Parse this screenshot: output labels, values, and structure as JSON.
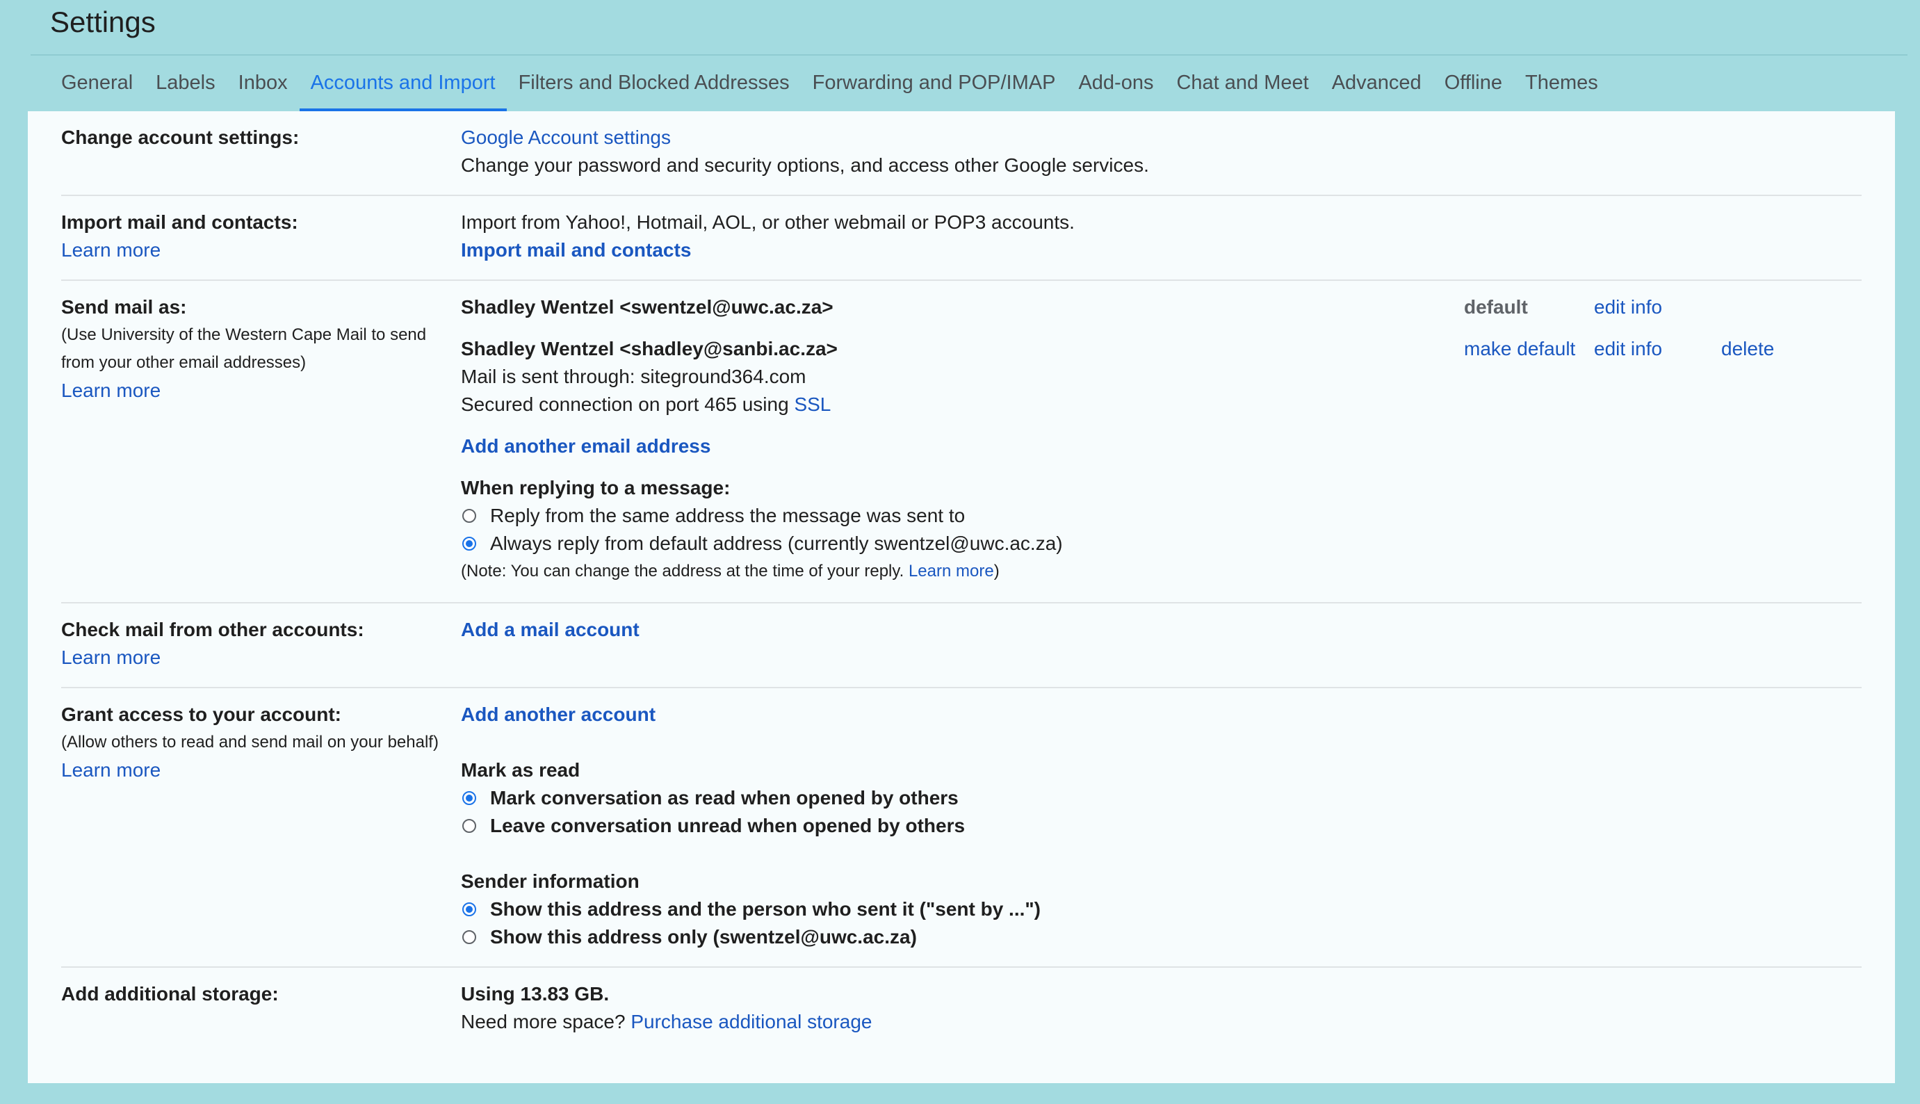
{
  "page": {
    "title": "Settings"
  },
  "tabs": [
    {
      "label": "General"
    },
    {
      "label": "Labels"
    },
    {
      "label": "Inbox"
    },
    {
      "label": "Accounts and Import"
    },
    {
      "label": "Filters and Blocked Addresses"
    },
    {
      "label": "Forwarding and POP/IMAP"
    },
    {
      "label": "Add-ons"
    },
    {
      "label": "Chat and Meet"
    },
    {
      "label": "Advanced"
    },
    {
      "label": "Offline"
    },
    {
      "label": "Themes"
    }
  ],
  "active_tab": "Accounts and Import",
  "change_account": {
    "label": "Change account settings:",
    "link": "Google Account settings",
    "description": "Change your password and security options, and access other Google services."
  },
  "import": {
    "label": "Import mail and contacts:",
    "learn_more": "Learn more",
    "description": "Import from Yahoo!, Hotmail, AOL, or other webmail or POP3 accounts.",
    "action": "Import mail and contacts"
  },
  "send_as": {
    "label": "Send mail as:",
    "note_line1": "(Use University of the Western Cape Mail to send",
    "note_line2": "from your other email addresses)",
    "learn_more": "Learn more",
    "accounts": [
      {
        "address": "Shadley Wentzel <swentzel@uwc.ac.za>",
        "status": "default",
        "edit": "edit info"
      },
      {
        "address": "Shadley Wentzel <shadley@sanbi.ac.za>",
        "status": "make default",
        "edit": "edit info",
        "delete": "delete",
        "sent_through": "Mail is sent through: siteground364.com",
        "secured_prefix": "Secured connection on port 465 using ",
        "secured_link": "SSL"
      }
    ],
    "add_address": "Add another email address",
    "reply_heading": "When replying to a message:",
    "reply_options": [
      {
        "label": "Reply from the same address the message was sent to",
        "checked": false
      },
      {
        "label": "Always reply from default address (currently swentzel@uwc.ac.za)",
        "checked": true
      }
    ],
    "reply_note_prefix": "(Note: You can change the address at the time of your reply. ",
    "reply_note_link": "Learn more",
    "reply_note_suffix": ")"
  },
  "check_mail": {
    "label": "Check mail from other accounts:",
    "learn_more": "Learn more",
    "action": "Add a mail account"
  },
  "grant_access": {
    "label": "Grant access to your account:",
    "note": "(Allow others to read and send mail on your behalf)",
    "learn_more": "Learn more",
    "action": "Add another account",
    "mark_heading": "Mark as read",
    "mark_options": [
      {
        "label": "Mark conversation as read when opened by others",
        "checked": true
      },
      {
        "label": "Leave conversation unread when opened by others",
        "checked": false
      }
    ],
    "sender_heading": "Sender information",
    "sender_options": [
      {
        "label": "Show this address and the person who sent it (\"sent by ...\")",
        "checked": true
      },
      {
        "label": "Show this address only (swentzel@uwc.ac.za)",
        "checked": false
      }
    ]
  },
  "storage": {
    "label": "Add additional storage:",
    "usage": "Using 13.83 GB.",
    "prompt": "Need more space? ",
    "link": "Purchase additional storage"
  },
  "colors": {
    "accent": "#1a73e8",
    "link": "#1a57c0",
    "background": "#a3dbe0"
  }
}
